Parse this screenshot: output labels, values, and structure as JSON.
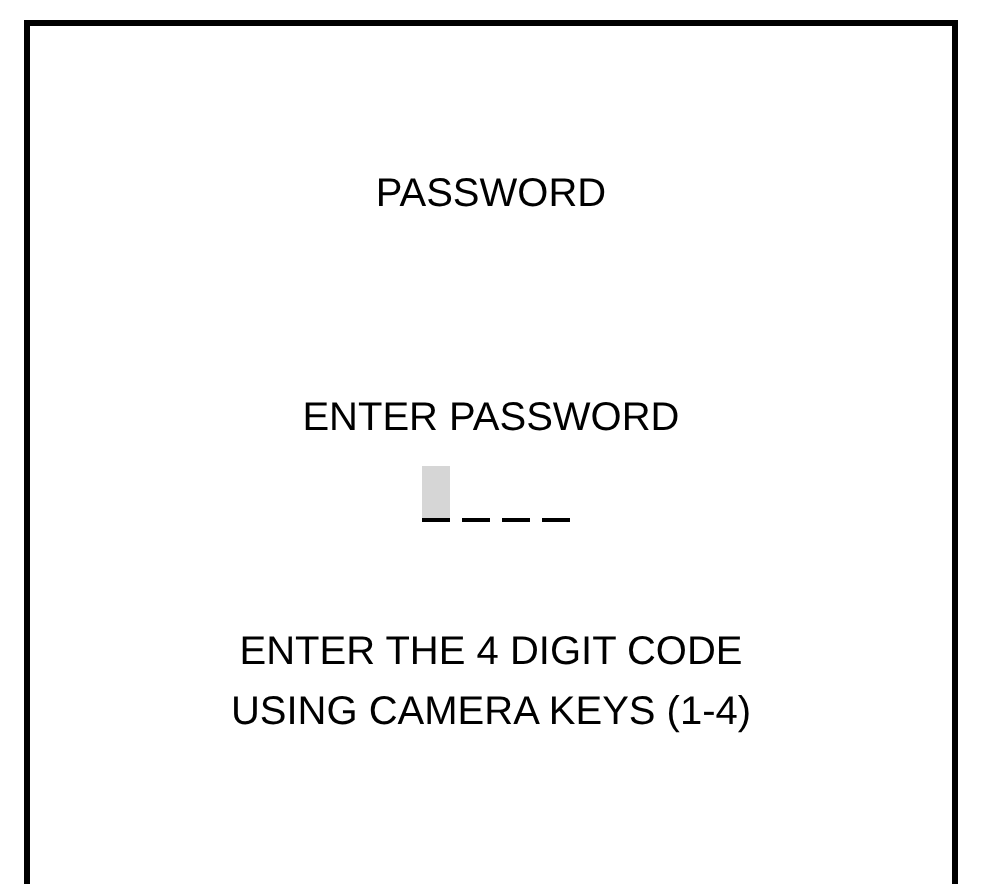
{
  "title": "PASSWORD",
  "prompt": "ENTER PASSWORD",
  "slots": [
    {
      "selected": true
    },
    {
      "selected": false
    },
    {
      "selected": false
    },
    {
      "selected": false
    }
  ],
  "instructions": [
    "ENTER THE 4 DIGIT CODE",
    "USING CAMERA KEYS (1-4)"
  ]
}
